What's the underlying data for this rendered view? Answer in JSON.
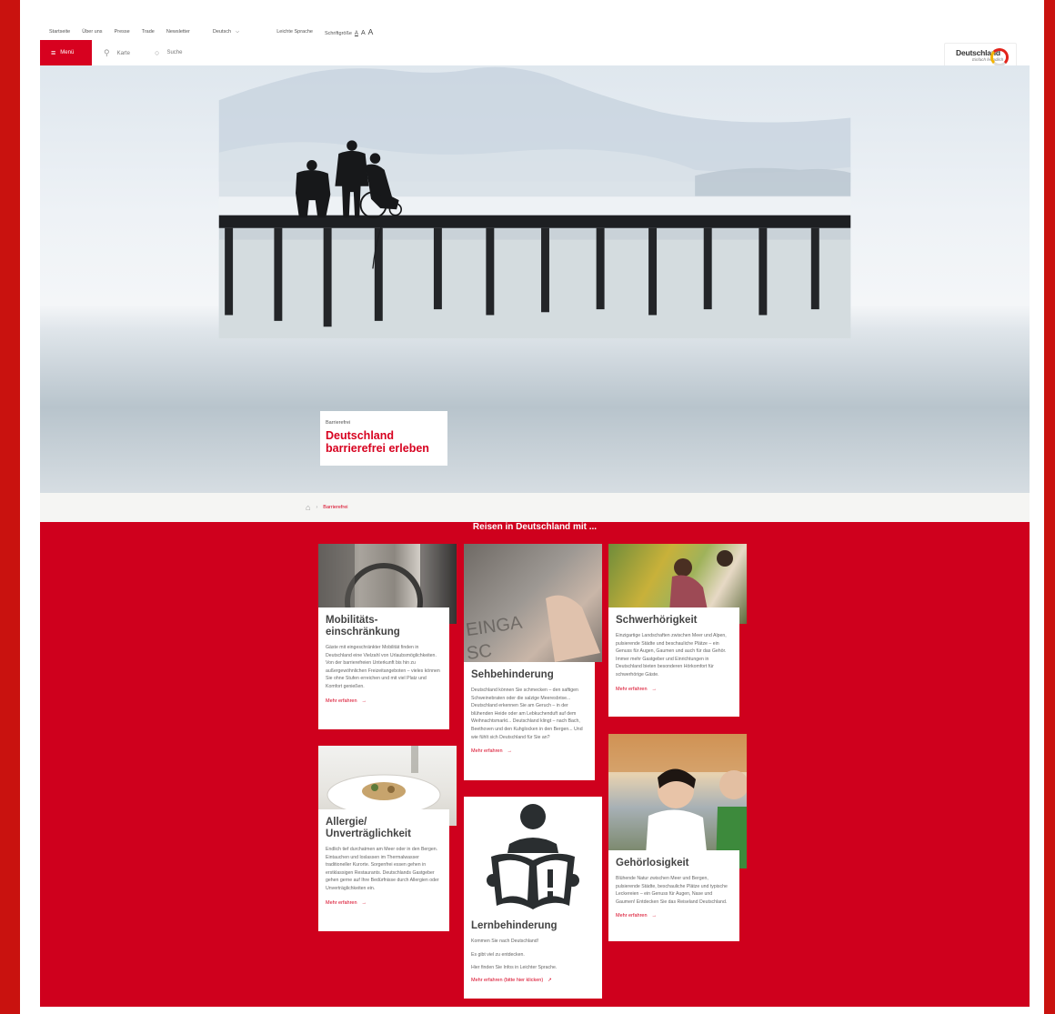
{
  "utility": {
    "links": [
      "Startseite",
      "Über uns",
      "Presse",
      "Trade",
      "Newsletter"
    ],
    "language": "Deutsch",
    "easy_language": "Leichte Sprache",
    "font_size_label": "Schriftgröße",
    "font_sizes": [
      "A",
      "A",
      "A"
    ]
  },
  "nav": {
    "menu": "Menü",
    "map": "Karte",
    "search": "Suche",
    "logo_title": "Deutschland",
    "logo_slogan": "Einfach feundlich"
  },
  "hero": {
    "kicker": "Barrierefrei",
    "title_line1": "Deutschland",
    "title_line2": "barrierefrei erleben"
  },
  "breadcrumb": {
    "current": "Barrierefrei"
  },
  "section": {
    "title": "Reisen in Deutschland mit ..."
  },
  "cards": {
    "mobility": {
      "title_line1": "Mobilitäts-",
      "title_line2": "einschränkung",
      "text": "Gäste mit eingeschränkter Mobilität finden in Deutschland eine Vielzahl von Urlaubsmöglichkeiten. Von der barrierefreien Unterkunft bis hin zu außergewöhnlichen Freizeitangeboten – vieles können Sie ohne Stufen erreichen und mit viel Platz und Komfort genießen.",
      "more": "Mehr erfahren"
    },
    "vision": {
      "title": "Sehbehinderung",
      "text": "Deutschland können Sie schmecken – den saftigen Schweinebraten oder die salzige Meeresbrise... Deutschland erkennen Sie am Geruch – in der blühenden Heide oder am Lebkuchenduft auf dem Weihnachtsmarkt... Deutschland klingt – nach Bach, Beethoven und den Kuhglocken in den Bergen... Und wie fühlt sich Deutschland für Sie an?",
      "more": "Mehr erfahren"
    },
    "hearing": {
      "title": "Schwerhörigkeit",
      "text": "Einzigartige Landschaften zwischen Meer und Alpen, pulsierende Städte und beschauliche Plätze – ein Genuss für Augen, Gaumen und auch für das Gehör. Immer mehr Gastgeber und Einrichtungen in Deutschland bieten besonderen Hörkomfort für schwerhörige Gäste.",
      "more": "Mehr erfahren"
    },
    "allergy": {
      "title_line1": "Allergie/",
      "title_line2": "Unverträglichkeit",
      "text": "Endlich tief durchatmen am Meer oder in den Bergen. Eintauchen und loslassen im Thermalwasser traditioneller Kurorte. Sorgenfrei essen gehen in erstklassigen Restaurants. Deutschlands Gastgeber gehen gerne auf Ihre Bedürfnisse durch Allergien oder Unverträglichkeiten ein.",
      "more": "Mehr erfahren"
    },
    "learning": {
      "title": "Lernbehinderung",
      "line1": "Kommen Sie nach Deutschland!",
      "line2": "Es gibt viel zu entdecken.",
      "line3": "Hier finden Sie Infos in Leichter Sprache.",
      "more": "Mehr erfahren (bitte hier klicken)"
    },
    "deaf": {
      "title": "Gehörlosigkeit",
      "text": "Blühende Natur zwischen Meer und Bergen, pulsierende Städte, beschauliche Plätze und typische Leckereien – ein Genuss für Augen, Nase und Gaumen! Entdecken Sie das Reiseland Deutschland.",
      "more": "Mehr erfahren"
    }
  }
}
